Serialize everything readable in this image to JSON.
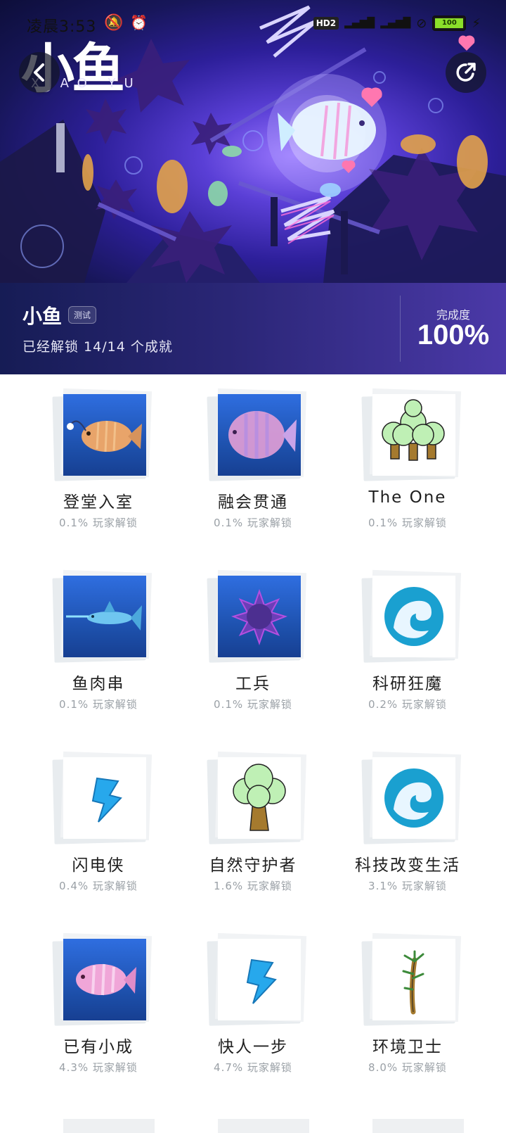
{
  "status_bar": {
    "time": "凌晨3:53",
    "network_badge": "HD2",
    "signal_1": "4G",
    "signal_2": "5G",
    "battery_level": "100",
    "icons": [
      "mute-icon",
      "alarm-icon",
      "hotspot-icon",
      "nfc-icon",
      "wifi-icon",
      "signal-icon",
      "battery-icon",
      "charging-icon"
    ]
  },
  "hero": {
    "logo_text": "小鱼",
    "logo_sub": "XIAO YU",
    "back_icon": "chevron-left-icon",
    "share_icon": "share-icon"
  },
  "info": {
    "game_title": "小鱼",
    "badge": "测试",
    "unlock_text": "已经解锁 14/14 个成就",
    "completion_label": "完成度",
    "completion_value": "100%"
  },
  "achievements": [
    {
      "title": "登堂入室",
      "rate": "0.1% 玩家解锁",
      "icon": "anglerfish-icon"
    },
    {
      "title": "融会贯通",
      "rate": "0.1% 玩家解锁",
      "icon": "angelfish-icon"
    },
    {
      "title": "The One",
      "rate": "0.1% 玩家解锁",
      "icon": "forest-icon"
    },
    {
      "title": "鱼肉串",
      "rate": "0.1% 玩家解锁",
      "icon": "swordfish-icon"
    },
    {
      "title": "工兵",
      "rate": "0.1% 玩家解锁",
      "icon": "sea-mine-icon"
    },
    {
      "title": "科研狂魔",
      "rate": "0.2% 玩家解锁",
      "icon": "wave-icon"
    },
    {
      "title": "闪电侠",
      "rate": "0.4% 玩家解锁",
      "icon": "lightning-icon"
    },
    {
      "title": "自然守护者",
      "rate": "1.6% 玩家解锁",
      "icon": "tree-icon"
    },
    {
      "title": "科技改变生活",
      "rate": "3.1% 玩家解锁",
      "icon": "wave-icon"
    },
    {
      "title": "已有小成",
      "rate": "4.3% 玩家解锁",
      "icon": "pink-fish-icon"
    },
    {
      "title": "快人一步",
      "rate": "4.7% 玩家解锁",
      "icon": "lightning-icon"
    },
    {
      "title": "环境卫士",
      "rate": "8.0% 玩家解锁",
      "icon": "sapling-icon"
    }
  ]
}
